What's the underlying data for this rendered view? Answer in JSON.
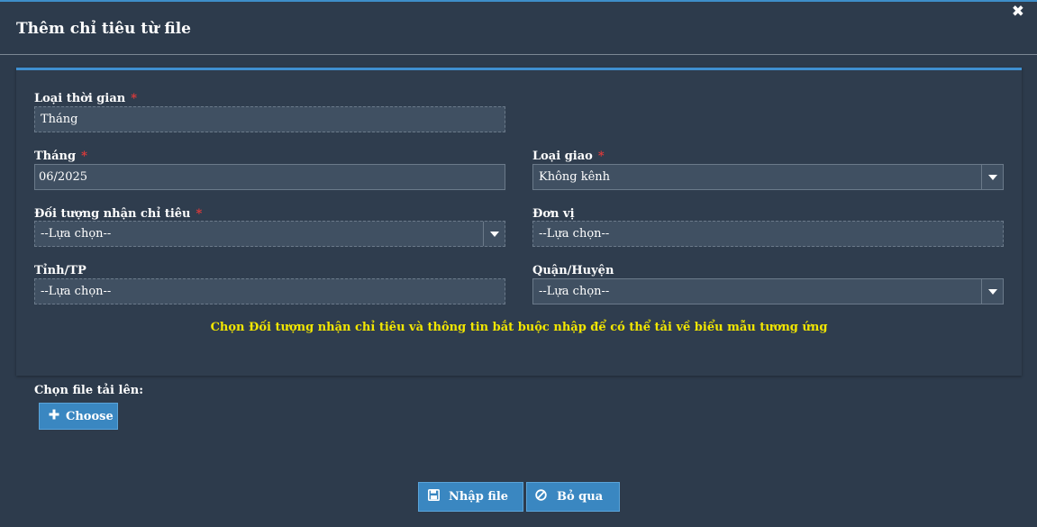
{
  "dialog": {
    "title": "Thêm chỉ tiêu từ file",
    "close_icon": "✖"
  },
  "form": {
    "loai_thoi_gian": {
      "label": "Loại thời gian",
      "value": "Tháng"
    },
    "thang": {
      "label": "Tháng",
      "value": "06/2025"
    },
    "loai_giao": {
      "label": "Loại giao",
      "value": "Không kênh"
    },
    "doi_tuong": {
      "label": "Đối tượng nhận chỉ tiêu",
      "value": "--Lựa chọn--"
    },
    "don_vi": {
      "label": "Đơn vị",
      "value": "--Lựa chọn--"
    },
    "tinh_tp": {
      "label": "Tỉnh/TP",
      "value": "--Lựa chọn--"
    },
    "quan_huyen": {
      "label": "Quận/Huyện",
      "value": "--Lựa chọn--"
    },
    "required_mark": "*",
    "hint": "Chọn Đối tượng nhận chỉ tiêu và thông tin bắt buộc nhập để có thể tải về biểu mẫu tương ứng"
  },
  "upload": {
    "label": "Chọn file tải lên:",
    "choose_label": "Choose",
    "choose_icon": "plus-icon"
  },
  "footer": {
    "import_label": "Nhập file",
    "import_icon": "save-icon",
    "cancel_label": "Bỏ qua",
    "cancel_icon": "ban-icon"
  },
  "colors": {
    "background": "#2d3b4c",
    "accent": "#3a87c1",
    "hint": "#f2e600",
    "required": "#e03a3a"
  }
}
